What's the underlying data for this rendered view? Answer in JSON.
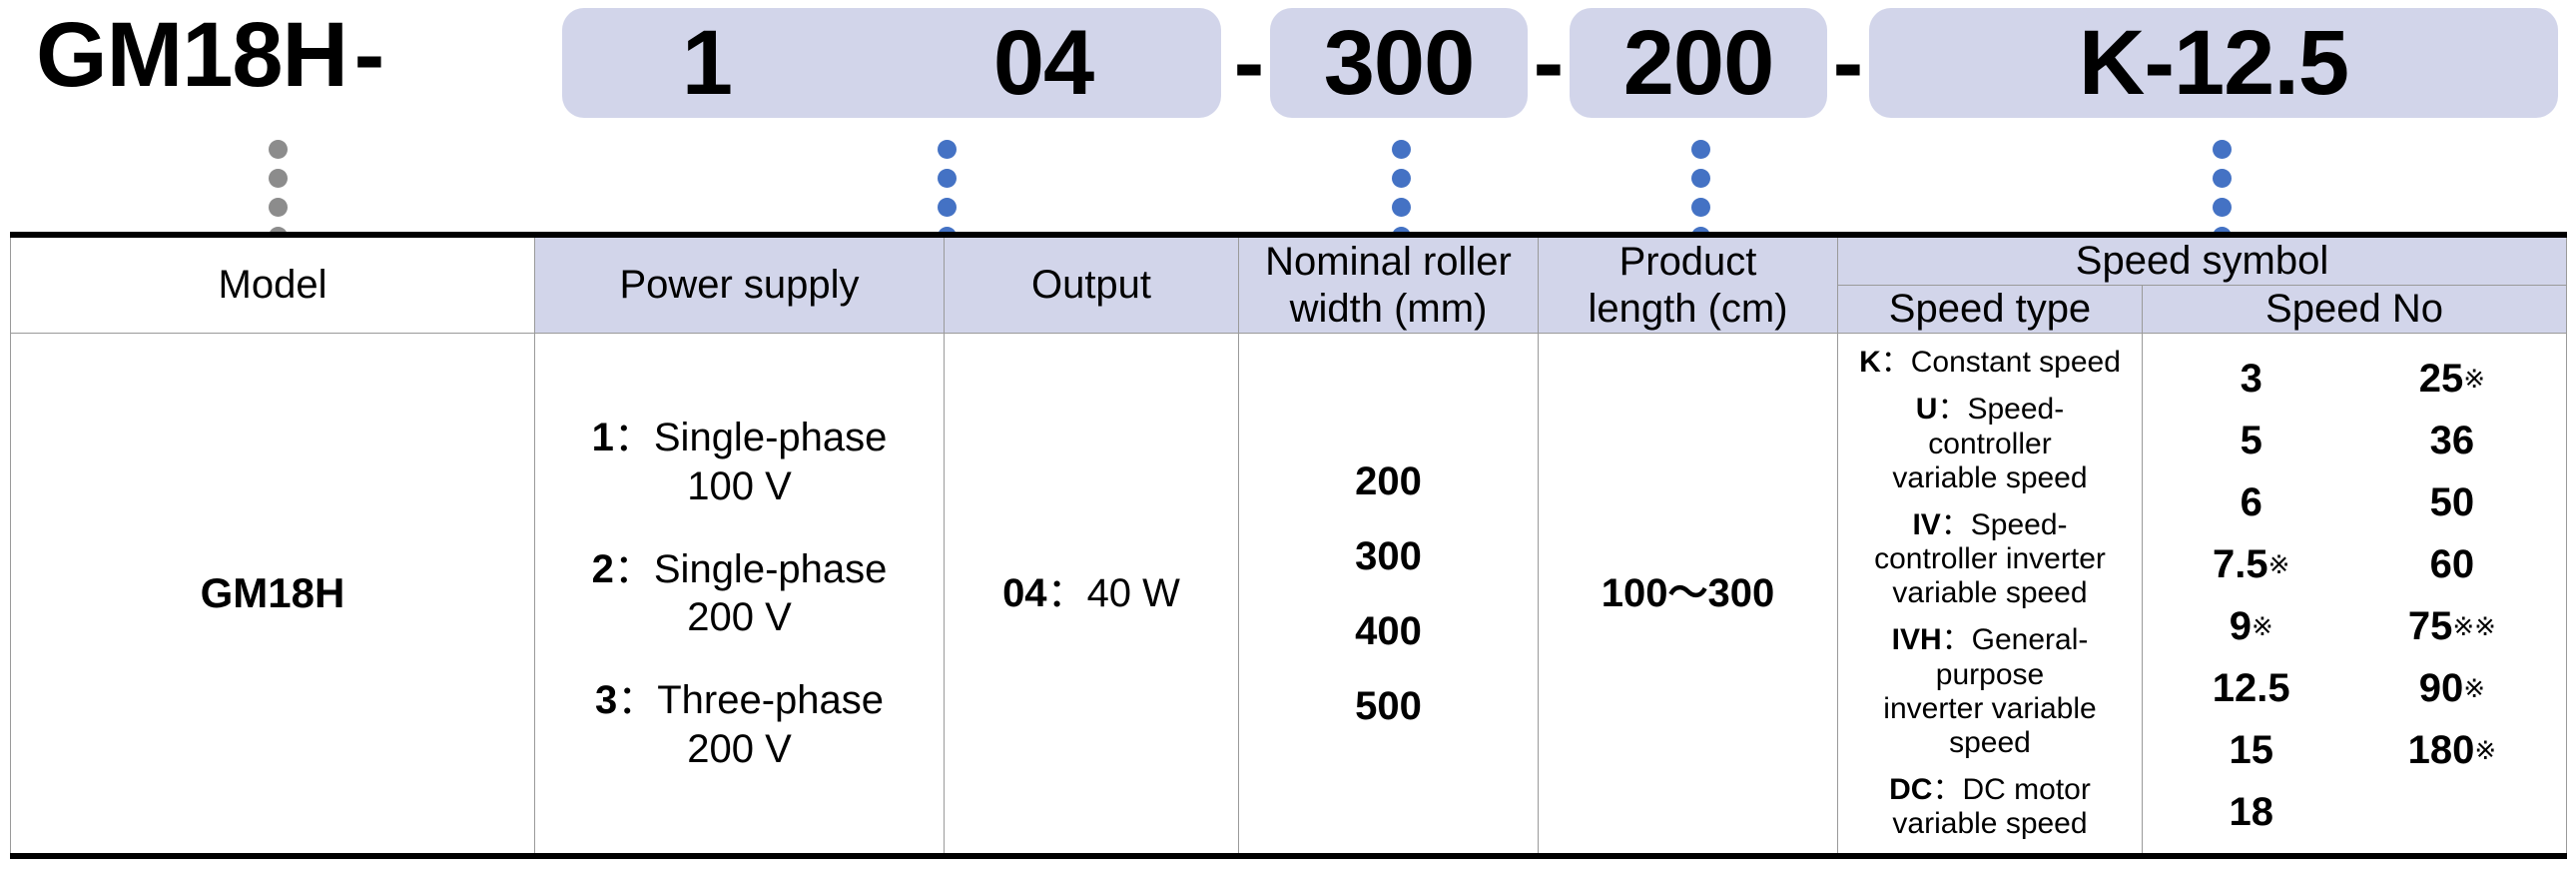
{
  "model_code": {
    "prefix": "GM18H",
    "separator": "-",
    "segments": [
      {
        "id": "power",
        "label": "1"
      },
      {
        "id": "output",
        "label": "04"
      },
      {
        "id": "roller_width",
        "label": "300"
      },
      {
        "id": "product_length",
        "label": "200"
      },
      {
        "id": "speed_symbol",
        "label": "K-12.5"
      }
    ]
  },
  "connectors": {
    "gray_color": "#8c8c8c",
    "blue_color": "#4472c4",
    "dots_per_column": 4,
    "columns": [
      {
        "target": "model",
        "color": "gray"
      },
      {
        "target": "power-supply",
        "color": "blue"
      },
      {
        "target": "output",
        "color": "blue"
      },
      {
        "target": "nominal-roller-width",
        "color": "blue"
      },
      {
        "target": "product-length",
        "color": "blue"
      },
      {
        "target": "speed-symbol",
        "color": "blue"
      }
    ]
  },
  "table": {
    "headers": {
      "model": "Model",
      "power_supply": "Power supply",
      "output": "Output",
      "roller_width": "Nominal roller\nwidth (mm)",
      "roller_width_l1": "Nominal roller",
      "roller_width_l2": "width (mm)",
      "product_length_l1": "Product",
      "product_length_l2": "length (cm)",
      "speed_symbol": "Speed symbol",
      "speed_type": "Speed type",
      "speed_no": "Speed No"
    },
    "body": {
      "model": "GM18H",
      "power_supply": [
        {
          "code": "1",
          "colon": "：",
          "desc_l1": "Single-phase",
          "desc_l2": "100 V"
        },
        {
          "code": "2",
          "colon": "：",
          "desc_l1": "Single-phase",
          "desc_l2": "200 V"
        },
        {
          "code": "3",
          "colon": "：",
          "desc_l1": "Three-phase",
          "desc_l2": "200 V"
        }
      ],
      "output": {
        "code": "04",
        "colon": "：",
        "value": "40 W"
      },
      "roller_widths": [
        "200",
        "300",
        "400",
        "500"
      ],
      "product_length": "100〜300",
      "speed_types": [
        {
          "code": "K",
          "colon": "：",
          "desc": "Constant speed"
        },
        {
          "code": "U",
          "colon": "：",
          "desc": "Speed-\ncontroller\nvariable speed",
          "d1": "Speed-",
          "d2": "controller",
          "d3": "variable speed"
        },
        {
          "code": "IV",
          "colon": "：",
          "desc": "Speed-\ncontroller inverter\nvariable speed",
          "d1": "Speed-",
          "d2": "controller inverter",
          "d3": "variable speed"
        },
        {
          "code": "IVH",
          "colon": "：",
          "desc": "General-\npurpose\ninverter variable\nspeed",
          "d1": "General-",
          "d2": "purpose",
          "d3": "inverter variable",
          "d4": "speed"
        },
        {
          "code": "DC",
          "colon": "：",
          "desc": "DC motor\nvariable speed",
          "d1": "DC motor",
          "d2": "variable speed"
        }
      ],
      "speed_no_left": [
        {
          "value": "3",
          "marks": ""
        },
        {
          "value": "5",
          "marks": ""
        },
        {
          "value": "6",
          "marks": ""
        },
        {
          "value": "7.5",
          "marks": "※"
        },
        {
          "value": "9",
          "marks": "※"
        },
        {
          "value": "12.5",
          "marks": ""
        },
        {
          "value": "15",
          "marks": ""
        },
        {
          "value": "18",
          "marks": ""
        }
      ],
      "speed_no_right": [
        {
          "value": "25",
          "marks": "※"
        },
        {
          "value": "36",
          "marks": ""
        },
        {
          "value": "50",
          "marks": ""
        },
        {
          "value": "60",
          "marks": ""
        },
        {
          "value": "75",
          "marks": "※※"
        },
        {
          "value": "90",
          "marks": "※"
        },
        {
          "value": "180",
          "marks": "※"
        }
      ]
    }
  },
  "colors": {
    "header_fill": "#d2d5ea",
    "pill_fill": "#d2d5ea",
    "accent_blue": "#4472c4",
    "gray_dot": "#8c8c8c",
    "grid_line": "#9a9a9a",
    "outer_rule": "#000000"
  }
}
